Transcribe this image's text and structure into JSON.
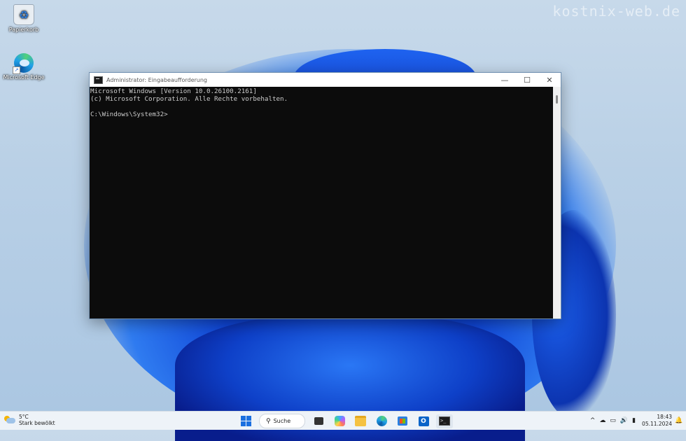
{
  "watermark": "kostnix-web.de",
  "desktop": {
    "icons": [
      {
        "label": "Papierkorb",
        "icon": "recycle-bin-icon"
      },
      {
        "label": "Microsoft Edge",
        "icon": "edge-icon"
      }
    ]
  },
  "window": {
    "title": "Administrator: Eingabeaufforderung",
    "controls": {
      "minimize": "—",
      "maximize": "☐",
      "close": "✕"
    },
    "console_lines": [
      "Microsoft Windows [Version 10.0.26100.2161]",
      "(c) Microsoft Corporation. Alle Rechte vorbehalten.",
      "",
      "C:\\Windows\\System32>"
    ]
  },
  "taskbar": {
    "weather": {
      "temp": "5°C",
      "condition": "Stark bewölkt"
    },
    "search_label": "Suche",
    "apps": [
      "start",
      "search",
      "task-view",
      "copilot",
      "file-explorer",
      "edge",
      "store",
      "outlook",
      "terminal"
    ],
    "tray": {
      "chevron": "^",
      "cloud": "☁",
      "display": "▭",
      "volume": "🔊",
      "battery": "▮"
    },
    "clock": {
      "time": "18:43",
      "date": "05.11.2024"
    }
  },
  "colors": {
    "accent": "#1a6fe0",
    "console_bg": "#0c0c0c",
    "console_fg": "#cccccc"
  }
}
